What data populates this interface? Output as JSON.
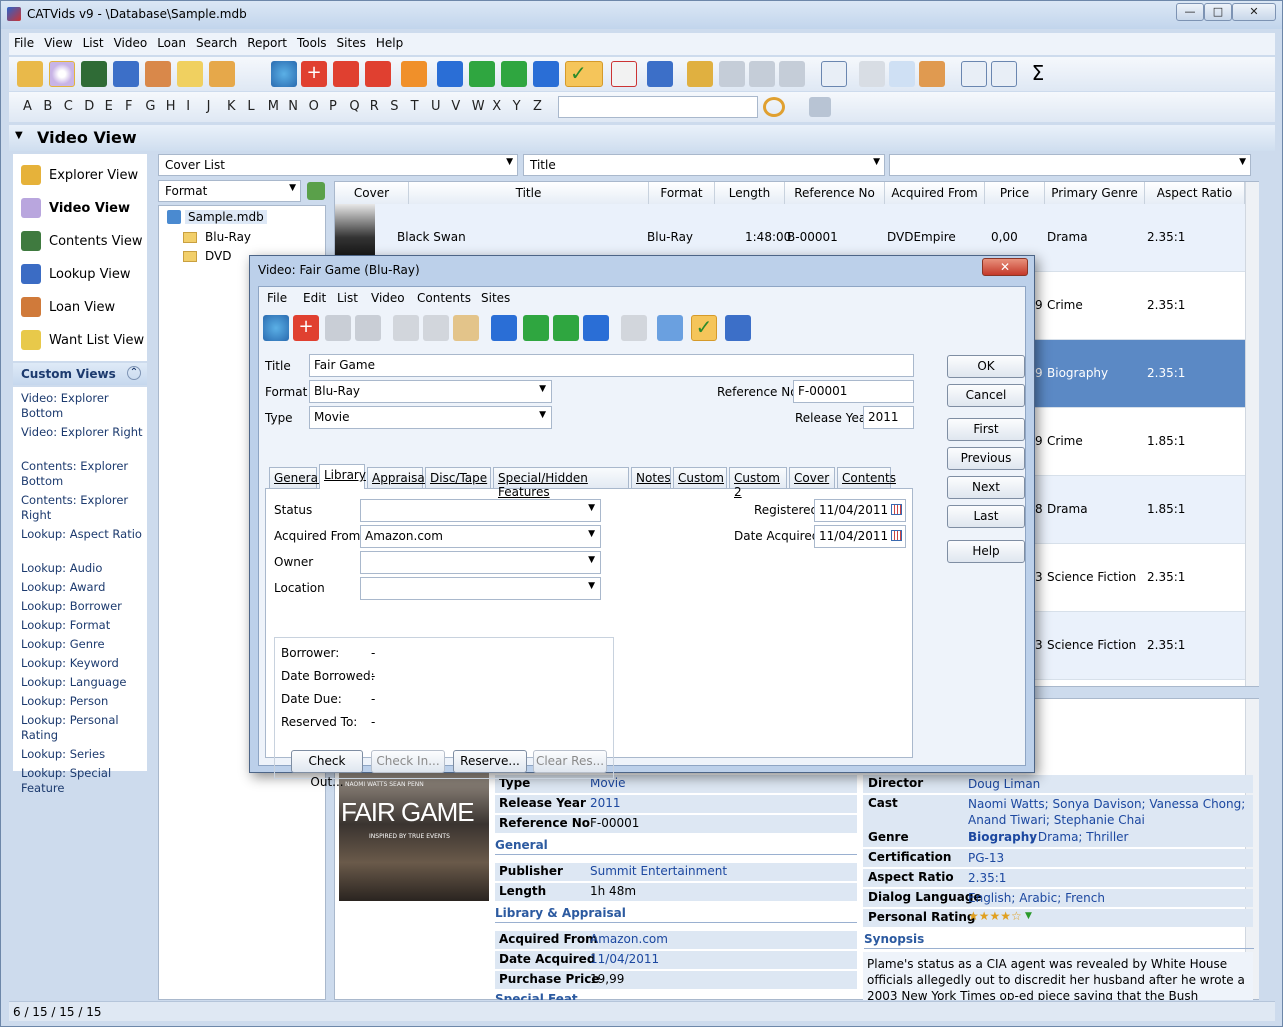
{
  "window": {
    "title": "CATVids v9 - \\Database\\Sample.mdb",
    "min": "—",
    "max": "□",
    "close": "✕"
  },
  "menu": [
    "File",
    "View",
    "List",
    "Video",
    "Loan",
    "Search",
    "Report",
    "Tools",
    "Sites",
    "Help"
  ],
  "alphabet": [
    "A",
    "B",
    "C",
    "D",
    "E",
    "F",
    "G",
    "H",
    "I",
    "J",
    "K",
    "L",
    "M",
    "N",
    "O",
    "P",
    "Q",
    "R",
    "S",
    "T",
    "U",
    "V",
    "W",
    "X",
    "Y",
    "Z"
  ],
  "view_header": "Video View",
  "nav": [
    {
      "label": "Explorer View",
      "icon": "home-icon",
      "color": "#e6b23a"
    },
    {
      "label": "Video View",
      "icon": "disc-icon",
      "color": "#b9a6de"
    },
    {
      "label": "Contents View",
      "icon": "film-icon",
      "color": "#3f7a3f"
    },
    {
      "label": "Lookup View",
      "icon": "grid-icon",
      "color": "#3b6cc4"
    },
    {
      "label": "Loan View",
      "icon": "people-icon",
      "color": "#d07a3a"
    },
    {
      "label": "Want List View",
      "icon": "list-icon",
      "color": "#e8c94a"
    }
  ],
  "custom_views": {
    "title": "Custom Views",
    "items": [
      "Video: Explorer Bottom",
      "Video: Explorer Right",
      "Contents: Explorer Bottom",
      "Contents: Explorer Right",
      "Lookup: Aspect Ratio",
      "Lookup: Audio",
      "Lookup: Award",
      "Lookup: Borrower",
      "Lookup: Format",
      "Lookup: Genre",
      "Lookup: Keyword",
      "Lookup: Language",
      "Lookup: Person",
      "Lookup: Personal Rating",
      "Lookup: Series",
      "Lookup: Special Feature"
    ]
  },
  "filters": {
    "cover_list": "Cover List",
    "title": "Title",
    "third": "",
    "format": "Format"
  },
  "tree": {
    "root": "Sample.mdb",
    "children": [
      "Blu-Ray",
      "DVD"
    ]
  },
  "grid": {
    "columns": [
      "Cover",
      "Title",
      "Format",
      "Length",
      "Reference No",
      "Acquired From",
      "Price",
      "Primary Genre",
      "Aspect Ratio"
    ],
    "rows": [
      {
        "title": "Black Swan",
        "format": "Blu-Ray",
        "length": "1:48:00",
        "ref": "B-00001",
        "from": "DVDEmpire",
        "price": "0,00",
        "genre": "Drama",
        "aspect": "2.35:1",
        "price_tail": ""
      },
      {
        "title": "",
        "format": "",
        "length": "",
        "ref": "",
        "from": "",
        "price": "",
        "genre": "Crime",
        "aspect": "2.35:1",
        "price_tail": "9"
      },
      {
        "title": "",
        "format": "",
        "length": "",
        "ref": "",
        "from": "",
        "price": "",
        "genre": "Biography",
        "aspect": "2.35:1",
        "price_tail": "9"
      },
      {
        "title": "",
        "format": "",
        "length": "",
        "ref": "",
        "from": "",
        "price": "",
        "genre": "Crime",
        "aspect": "1.85:1",
        "price_tail": "9"
      },
      {
        "title": "",
        "format": "",
        "length": "",
        "ref": "",
        "from": "",
        "price": "",
        "genre": "Drama",
        "aspect": "1.85:1",
        "price_tail": "8"
      },
      {
        "title": "",
        "format": "",
        "length": "",
        "ref": "",
        "from": "",
        "price": "",
        "genre": "Science Fiction",
        "aspect": "2.35:1",
        "price_tail": "3"
      },
      {
        "title": "",
        "format": "",
        "length": "",
        "ref": "",
        "from": "",
        "price": "",
        "genre": "Science Fiction",
        "aspect": "2.35:1",
        "price_tail": "3"
      }
    ]
  },
  "detail": {
    "left": [
      {
        "k": "Type",
        "v": "Movie",
        "link": true
      },
      {
        "k": "Release Year",
        "v": "2011",
        "link": true
      },
      {
        "k": "Reference No",
        "v": "F-00001",
        "link": false
      }
    ],
    "general_title": "General",
    "general": [
      {
        "k": "Publisher",
        "v": "Summit Entertainment",
        "link": true
      },
      {
        "k": "Length",
        "v": "1h 48m",
        "link": false
      }
    ],
    "library_title": "Library & Appraisal",
    "library": [
      {
        "k": "Acquired From",
        "v": "Amazon.com",
        "link": true
      },
      {
        "k": "Date Acquired",
        "v": "11/04/2011",
        "link": true
      },
      {
        "k": "Purchase Price",
        "v": "19,99",
        "link": false
      }
    ],
    "cut_section": "Special Feat",
    "right": [
      {
        "k": "Director",
        "v": "Doug Liman"
      },
      {
        "k": "Cast",
        "v": "Naomi Watts; Sonya Davison; Vanessa Chong; Anand Tiwari; Stephanie Chai"
      },
      {
        "k": "Genre",
        "v_bold": "Biography",
        "v": "; Drama; Thriller"
      },
      {
        "k": "Certification",
        "v": "PG-13"
      },
      {
        "k": "Aspect Ratio",
        "v": "2.35:1"
      },
      {
        "k": "Dialog Language",
        "v": "English; Arabic; French"
      },
      {
        "k": "Personal Rating",
        "v": "★★★★☆"
      }
    ],
    "synopsis_title": "Synopsis",
    "synopsis": "Plame's status as a CIA agent was revealed by White House officials allegedly out to discredit her husband after he wrote a 2003 New York Times op-ed piece saying that the Bush administration had manipulated",
    "poster": {
      "actors": "NAOMI WATTS    SEAN PENN",
      "title": "FAIR GAME",
      "tag": "INSPIRED BY TRUE EVENTS"
    }
  },
  "status": "6 / 15 / 15 / 15",
  "dialog": {
    "title": "Video: Fair Game (Blu-Ray)",
    "menu": [
      "File",
      "Edit",
      "List",
      "Video",
      "Contents",
      "Sites"
    ],
    "title_label": "Title",
    "title_value": "Fair Game",
    "format_label": "Format",
    "format_value": "Blu-Ray",
    "type_label": "Type",
    "type_value": "Movie",
    "ref_label": "Reference No",
    "ref_value": "F-00001",
    "year_label": "Release Year",
    "year_value": "2011",
    "tabs": [
      "General",
      "Library",
      "Appraisal",
      "Disc/Tape",
      "Special/Hidden Features",
      "Notes",
      "Custom",
      "Custom 2",
      "Cover",
      "Contents"
    ],
    "status_label": "Status",
    "status_value": "",
    "acq_label": "Acquired From",
    "acq_value": "Amazon.com",
    "owner_label": "Owner",
    "owner_value": "",
    "loc_label": "Location",
    "loc_value": "",
    "reg_label": "Registered",
    "reg_value": "11/04/2011",
    "dacq_label": "Date Acquired",
    "dacq_value": "11/04/2011",
    "loan": [
      {
        "k": "Borrower:",
        "v": "-"
      },
      {
        "k": "Date Borrowed:",
        "v": "-"
      },
      {
        "k": "Date Due:",
        "v": "-"
      },
      {
        "k": "Reserved To:",
        "v": "-"
      }
    ],
    "loan_buttons": [
      "Check Out...",
      "Check In...",
      "Reserve...",
      "Clear Res..."
    ],
    "buttons": [
      "OK",
      "Cancel",
      "First",
      "Previous",
      "Next",
      "Last",
      "Help"
    ]
  }
}
